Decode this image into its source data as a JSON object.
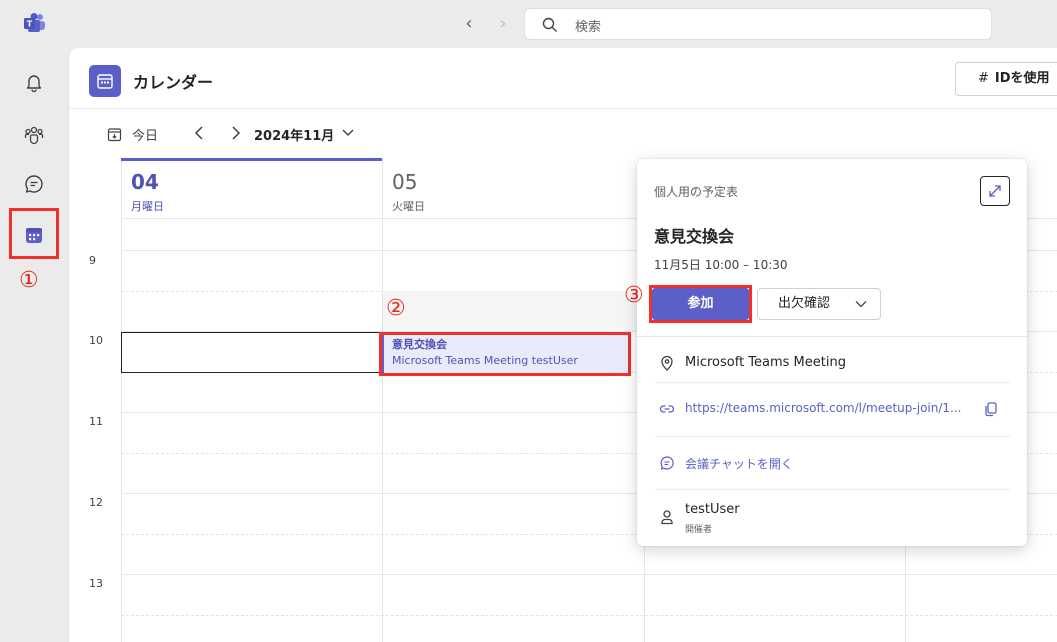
{
  "search": {
    "placeholder": "検索"
  },
  "header": {
    "title": "カレンダー",
    "join_id_button": "IDを使用"
  },
  "toolbar": {
    "today_label": "今日",
    "month_label": "2024年11月"
  },
  "days": [
    {
      "num": "04",
      "name": "月曜日"
    },
    {
      "num": "05",
      "name": "火曜日"
    }
  ],
  "hours": [
    "9",
    "10",
    "11",
    "12",
    "13"
  ],
  "event": {
    "title": "意見交換会",
    "subtitle": "Microsoft Teams Meeting  testUser"
  },
  "popup": {
    "calendar_name": "個人用の予定表",
    "title": "意見交換会",
    "time": "11月5日 10:00 – 10:30",
    "join_label": "参加",
    "rsvp_label": "出欠確認",
    "location": "Microsoft Teams Meeting",
    "link": "https://teams.microsoft.com/l/meetup-join/1...",
    "chat_label": "会議チャットを開く",
    "organizer_name": "testUser",
    "organizer_role": "開催者"
  },
  "annotations": {
    "a1": "①",
    "a2": "②",
    "a3": "③"
  },
  "colors": {
    "accent": "#5b5fc7",
    "highlight": "#f0302a"
  }
}
